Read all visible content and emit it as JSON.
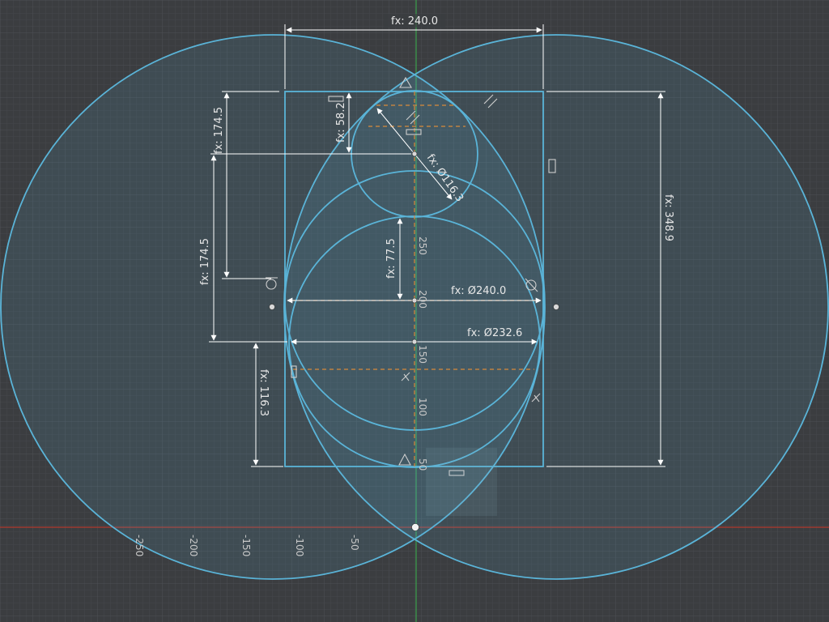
{
  "app": {
    "view": "sketch",
    "background_color": "#3b3d40",
    "grid_color": "#46494d",
    "sketch_color": "#5ab4d8",
    "sketch_fill": "#5ab4d8",
    "dimension_color": "#ffffff",
    "x_axis_color": "#c0392b",
    "y_axis_color": "#3aa04a",
    "construction_color": "#d98b3a"
  },
  "dimensions": {
    "top_width": "fx: 240.0",
    "right_height": "fx: 348.9",
    "left_upper_height": "fx: 174.5",
    "left_lower_height": "fx: 174.5",
    "small_circle_offset": "fx: 58.2",
    "small_circle_diameter": "fx: Ø116.3",
    "center_offset": "fx: 77.5",
    "big_circle_diameter": "fx: Ø240.0",
    "mid_circle_diameter": "fx: Ø232.6",
    "bottom_offset": "fx: 116.3"
  },
  "axis_labels": {
    "x_ticks": [
      "-250",
      "-200",
      "-150",
      "-100",
      "-50"
    ],
    "y_ticks": [
      "250",
      "200",
      "150",
      "100",
      "50"
    ]
  },
  "constraint_icons": [
    "triangle-constraint-icon",
    "parallel-constraint-icon",
    "horizontal-constraint-icon",
    "tangent-constraint-icon",
    "perpendicular-constraint-icon"
  ]
}
